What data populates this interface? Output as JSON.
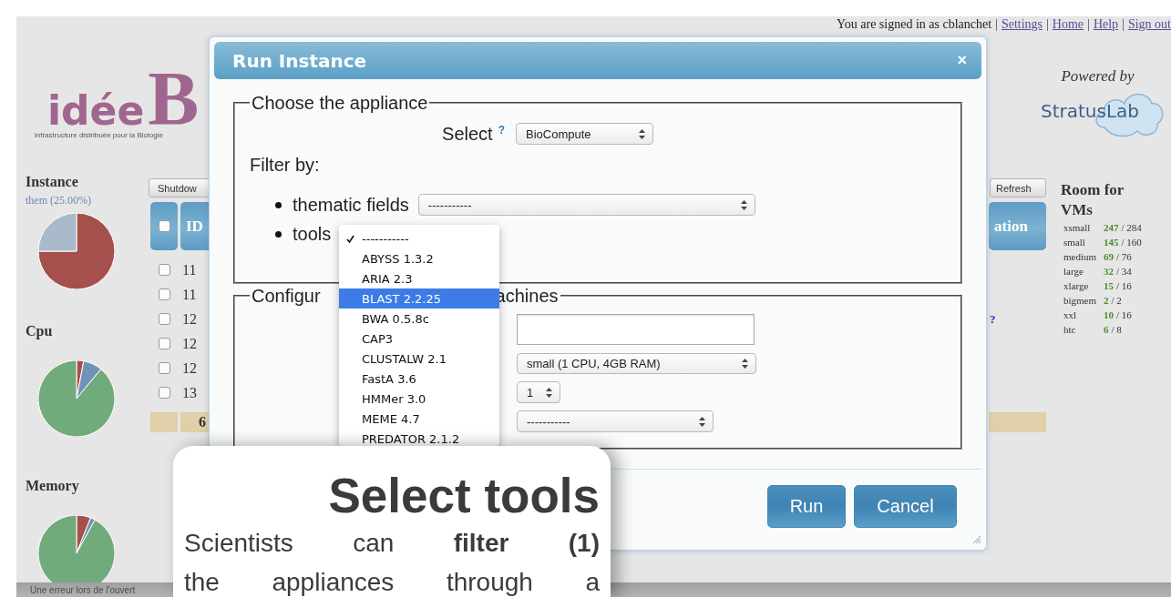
{
  "top_bar": {
    "user_text": "You are signed in as cblanchet",
    "links": [
      {
        "separator": "|",
        "label": "Settings"
      },
      {
        "separator": "|",
        "label": "Home"
      },
      {
        "separator": "|",
        "label": "Help"
      },
      {
        "separator": "|",
        "label": "Sign out"
      }
    ]
  },
  "logo": {
    "wordmark": "idée",
    "initial": "B",
    "tagline": "infrastructure distribuée pour la Biologie"
  },
  "sidebar": {
    "sections": [
      {
        "title": "Instance",
        "subtitle": "them (25.00%)"
      },
      {
        "title": "Cpu"
      },
      {
        "title": "Memory"
      }
    ]
  },
  "toolbar": {
    "buttons": [
      {
        "label": "Shutdow"
      },
      {
        "label": "Refresh"
      }
    ]
  },
  "table": {
    "header_checkbox": {
      "checked": false
    },
    "columns": [
      {
        "label": "ID"
      },
      {
        "label": "ation"
      }
    ],
    "rows": [
      {
        "checked": false,
        "id": "11"
      },
      {
        "checked": false,
        "id": "11"
      },
      {
        "checked": false,
        "id": "12",
        "link": "?"
      },
      {
        "checked": false,
        "id": "12"
      },
      {
        "checked": false,
        "id": "12"
      },
      {
        "checked": false,
        "id": "13"
      }
    ],
    "footer": {
      "count": "6"
    }
  },
  "right_panel": {
    "powered_by": "Powered by",
    "partner_logo": "StratusLab",
    "room_title": "Room for VMs",
    "rooms": [
      {
        "name": "xsmall",
        "free": "247",
        "total": "/ 284"
      },
      {
        "name": "small",
        "free": "145",
        "total": "/ 160"
      },
      {
        "name": "medium",
        "free": "69",
        "total": "/ 76"
      },
      {
        "name": "large",
        "free": "32",
        "total": "/ 34"
      },
      {
        "name": "xlarge",
        "free": "15",
        "total": "/ 16"
      },
      {
        "name": "bigmem",
        "free": "2",
        "total": "/ 2"
      },
      {
        "name": "xxl",
        "free": "10",
        "total": "/ 16"
      },
      {
        "name": "htc",
        "free": "6",
        "total": "/ 8"
      }
    ]
  },
  "dialog": {
    "title": "Run Instance",
    "close": "×",
    "appliance": {
      "legend": "Choose the appliance",
      "select_label": "Select",
      "help": "?",
      "select_value": "BioCompute",
      "filter_label": "Filter by:",
      "filters": [
        {
          "label": "thematic fields",
          "value": "-----------"
        },
        {
          "label": "tools"
        }
      ]
    },
    "machines": {
      "legend_parts": [
        "Configur",
        "achines"
      ],
      "fields": [
        {
          "kind": "text"
        },
        {
          "kind": "select",
          "value": "small (1 CPU, 4GB RAM)"
        },
        {
          "kind": "select",
          "value": "1"
        },
        {
          "kind": "select",
          "value": "-----------"
        }
      ]
    },
    "buttons": [
      {
        "label": "Run"
      },
      {
        "label": "Cancel"
      }
    ]
  },
  "dropdown": {
    "items": [
      {
        "label": "-----------",
        "checked": true,
        "selected": false
      },
      {
        "label": "ABYSS 1.3.2",
        "checked": false,
        "selected": false
      },
      {
        "label": "ARIA 2.3",
        "checked": false,
        "selected": false
      },
      {
        "label": "BLAST 2.2.25",
        "checked": false,
        "selected": true
      },
      {
        "label": "BWA 0.5.8c",
        "checked": false,
        "selected": false
      },
      {
        "label": "CAP3",
        "checked": false,
        "selected": false
      },
      {
        "label": "CLUSTALW 2.1",
        "checked": false,
        "selected": false
      },
      {
        "label": "FastA 3.6",
        "checked": false,
        "selected": false
      },
      {
        "label": "HMMer 3.0",
        "checked": false,
        "selected": false
      },
      {
        "label": "MEME 4.7",
        "checked": false,
        "selected": false
      },
      {
        "label": "PREDATOR 2.1.2",
        "checked": false,
        "selected": false
      }
    ]
  },
  "callout": {
    "title": "Select tools",
    "body": "Scientists can **filter (1)**\nthe appliances through a"
  },
  "status_bar": {
    "text": "Une erreur lors de l'ouvert"
  }
}
